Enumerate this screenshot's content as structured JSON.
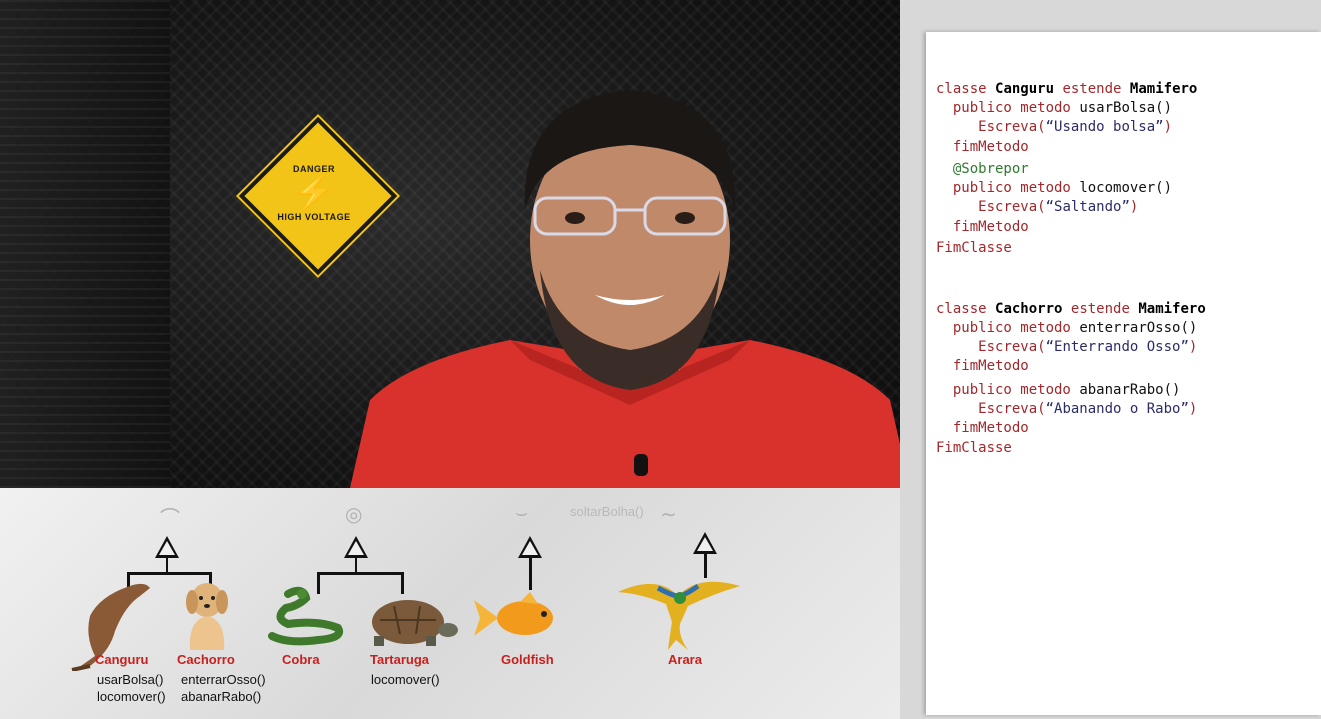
{
  "video": {
    "sign": {
      "top": "DANGER",
      "bottom": "HIGH VOLTAGE",
      "icon": "electric-creature-icon"
    }
  },
  "diagram": {
    "ghost_text": "soltarBolha()",
    "animals": [
      {
        "name": "Canguru",
        "methods": [
          "usarBolsa()",
          "locomover()"
        ],
        "icon": "kangaroo-icon"
      },
      {
        "name": "Cachorro",
        "methods": [
          "enterrarOsso()",
          "abanarRabo()"
        ],
        "icon": "dog-icon"
      },
      {
        "name": "Cobra",
        "methods": [],
        "icon": "snake-icon"
      },
      {
        "name": "Tartaruga",
        "methods": [
          "locomover()"
        ],
        "icon": "turtle-icon"
      },
      {
        "name": "Goldfish",
        "methods": [],
        "icon": "goldfish-icon"
      },
      {
        "name": "Arara",
        "methods": [],
        "icon": "macaw-icon"
      }
    ]
  },
  "code": {
    "block1": {
      "line1": {
        "kw1": "classe",
        "cls": "Canguru",
        "kw2": "estende",
        "parent": "Mamifero"
      },
      "line2": {
        "kw": "publico metodo",
        "name": "usarBolsa()"
      },
      "line3": {
        "kw": "Escreva(",
        "str": "“Usando bolsa”",
        "end": ")"
      },
      "line4": "fimMetodo",
      "line5": "@Sobrepor",
      "line6": {
        "kw": "publico metodo",
        "name": "locomover()"
      },
      "line7": {
        "kw": "Escreva(",
        "str": "“Saltando”",
        "end": ")"
      },
      "line8": "fimMetodo",
      "line9": "FimClasse"
    },
    "block2": {
      "line1": {
        "kw1": "classe",
        "cls": "Cachorro",
        "kw2": "estende",
        "parent": "Mamifero"
      },
      "line2": {
        "kw": "publico metodo",
        "name": "enterrarOsso()"
      },
      "line3": {
        "kw": "Escreva(",
        "str": "“Enterrando Osso”",
        "end": ")"
      },
      "line4": "fimMetodo",
      "line5": {
        "kw": "publico metodo",
        "name": "abanarRabo()"
      },
      "line6": {
        "kw": "Escreva(",
        "str": "“Abanando o Rabo”",
        "end": ")"
      },
      "line7": "fimMetodo",
      "line8": "FimClasse"
    }
  }
}
